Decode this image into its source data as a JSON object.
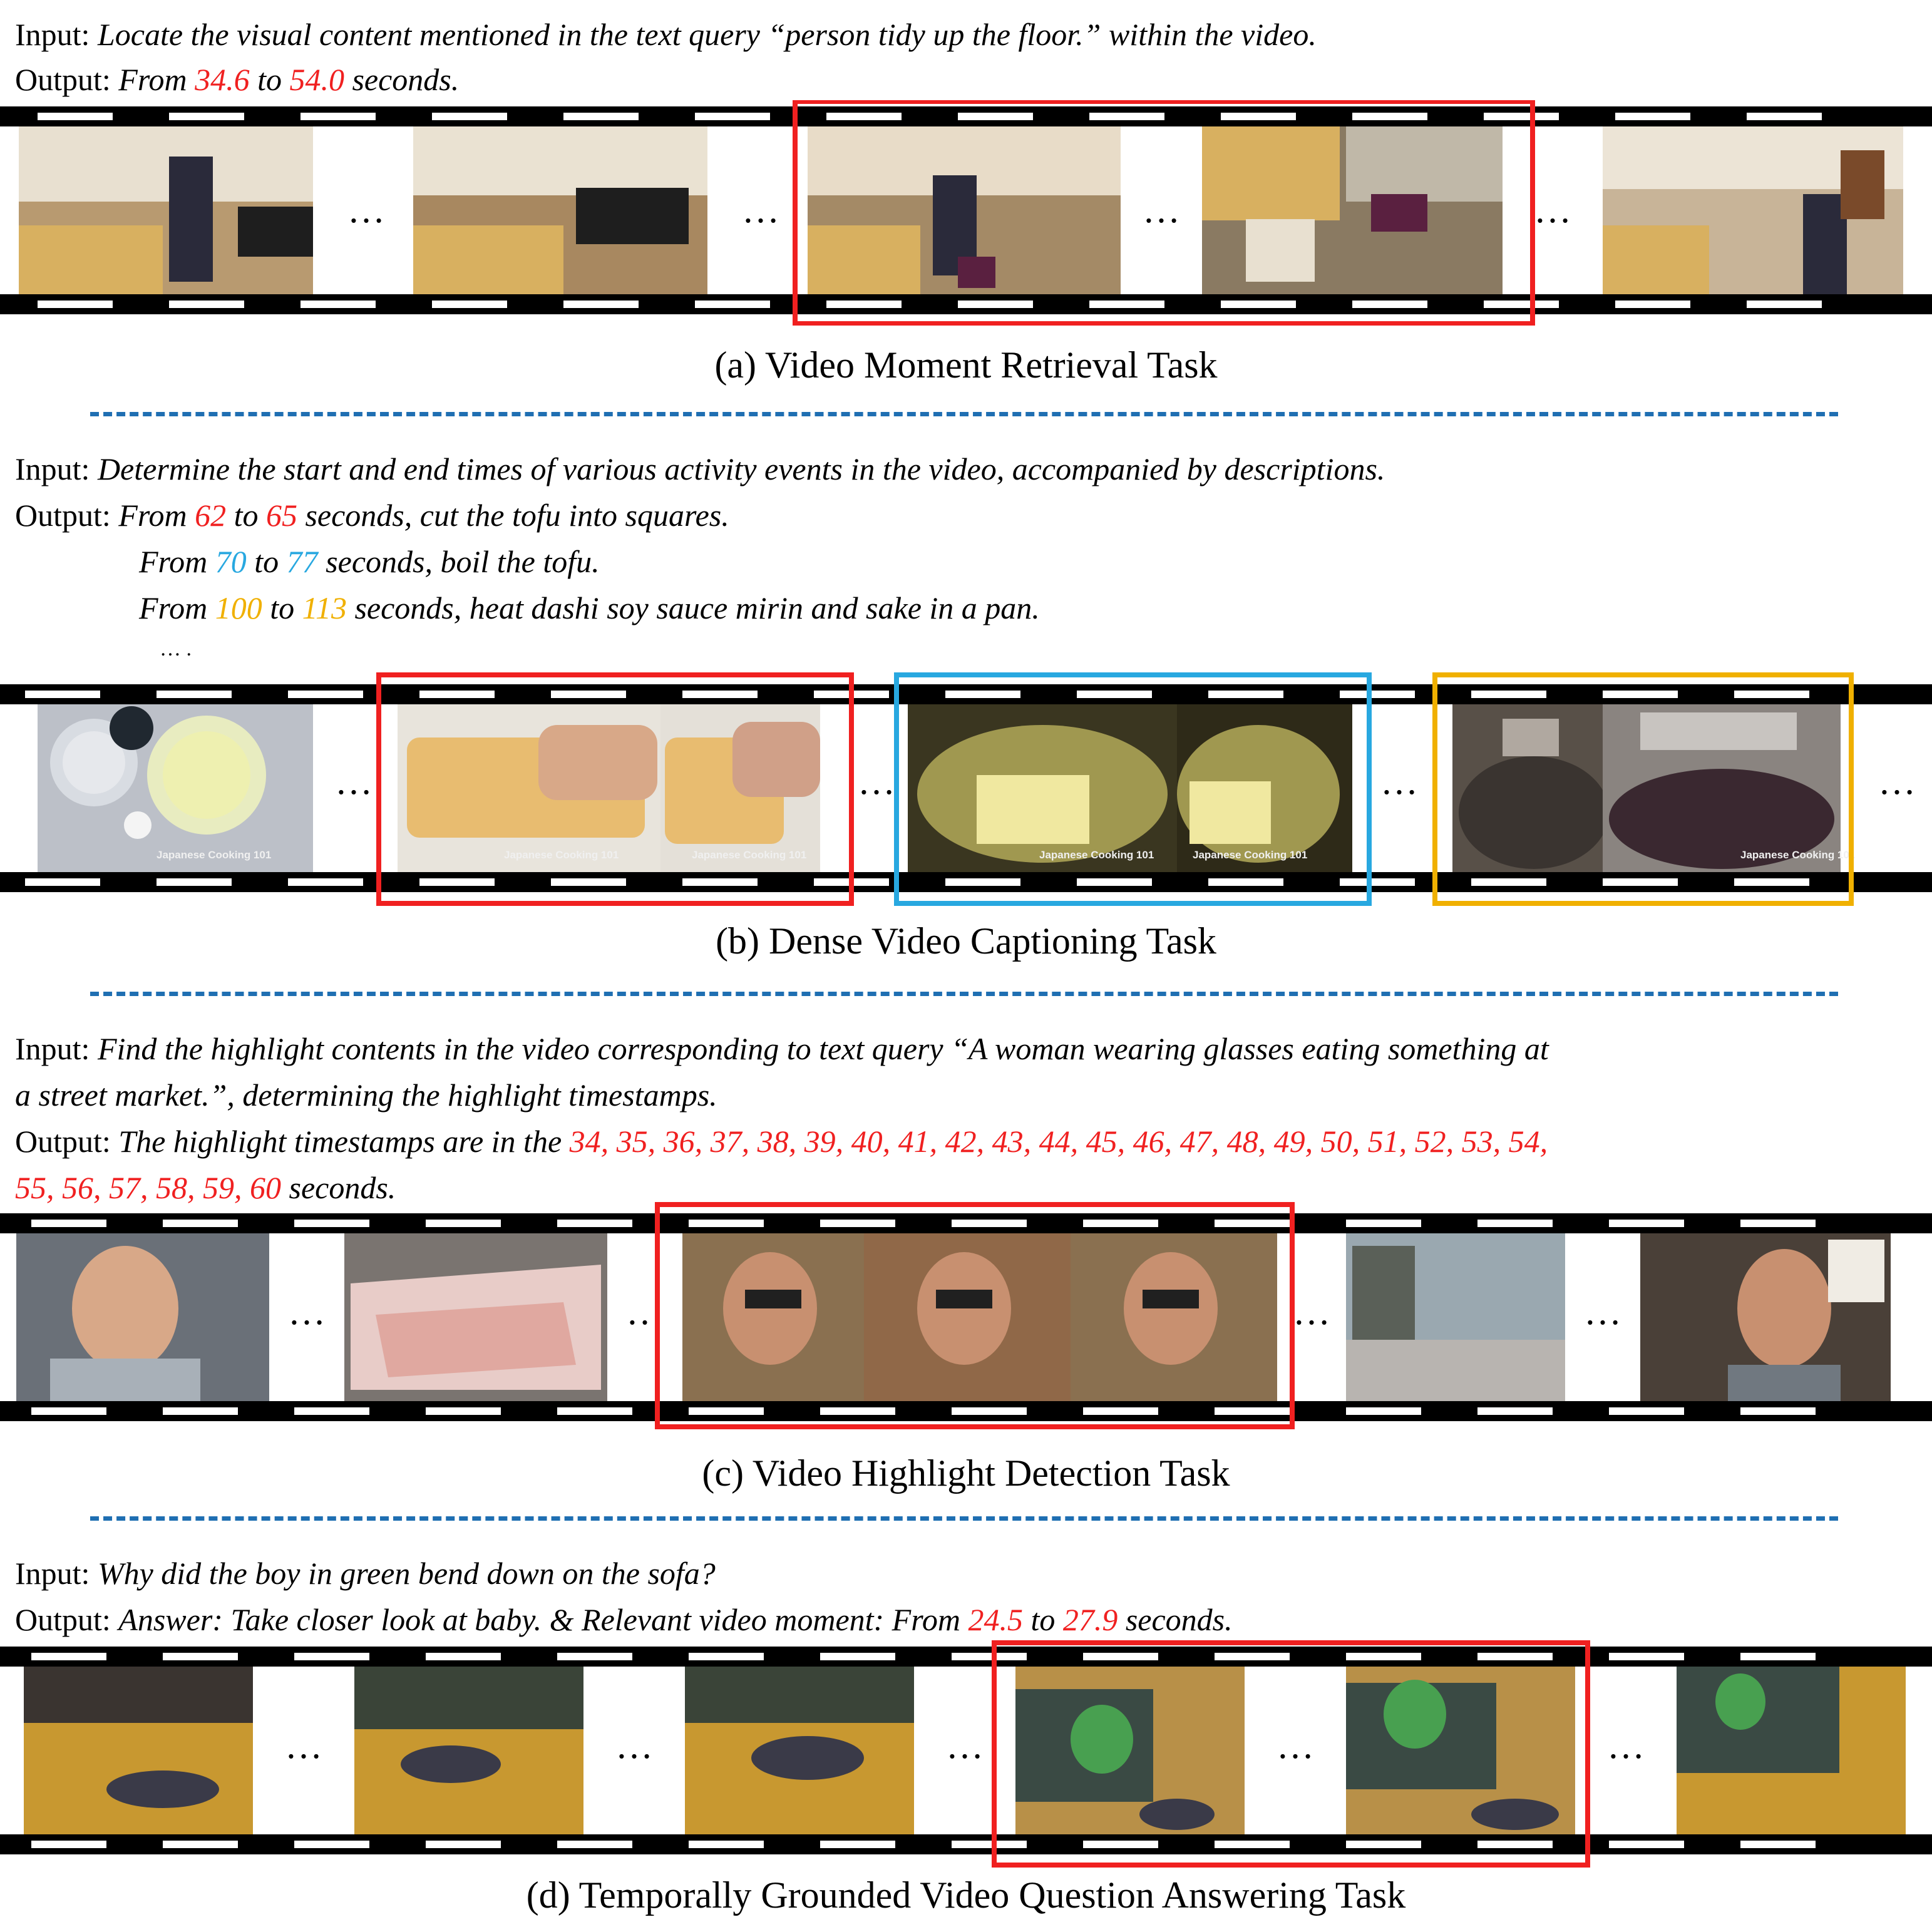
{
  "sections": [
    {
      "input_label": "Input:",
      "input_text": "Locate the visual content mentioned in the text query “person tidy up the floor.” within the video.",
      "output_label": "Output:",
      "output": {
        "a": "From ",
        "start": "34.6",
        "b": " to ",
        "end": "54.0",
        "c": " seconds."
      },
      "caption": "(a) Video Moment Retrieval Task"
    },
    {
      "input_label": "Input:",
      "input_text": "Determine the start and end times of various activity events in the video, accompanied by descriptions.",
      "output_label": "Output:",
      "events": [
        {
          "a": "From ",
          "start": "62",
          "b": " to ",
          "end": "65",
          "c": " seconds, cut the tofu into squares."
        },
        {
          "a": "From ",
          "start": "70",
          "b": " to ",
          "end": "77",
          "c": " seconds, boil the tofu."
        },
        {
          "a": "From ",
          "start": "100",
          "b": " to ",
          "end": "113",
          "c": " seconds, heat dashi soy sauce mirin and sake in a pan."
        }
      ],
      "more": "… .",
      "watermark": "Japanese Cooking 101",
      "caption": "(b) Dense Video Captioning Task"
    },
    {
      "input_label": "Input:",
      "input_line1": "Find the highlight contents in the video corresponding to text query “A woman wearing glasses eating something at",
      "input_line2": "a street market.”, determining the highlight timestamps.",
      "output_label": "Output:",
      "output_prefix": "The highlight timestamps are in the ",
      "timestamps_line1": "34, 35, 36, 37, 38, 39, 40, 41, 42, 43, 44, 45, 46, 47, 48, 49, 50, 51, 52, 53, 54,",
      "timestamps_line2": "55, 56, 57, 58, 59, 60",
      "output_suffix": " seconds.",
      "caption": "(c) Video Highlight Detection Task"
    },
    {
      "input_label": "Input:",
      "input_text": "Why did the boy in green bend down on the sofa?",
      "output_label": "Output:",
      "output": {
        "a": "Answer: Take closer look at baby. & Relevant video moment: From ",
        "start": "24.5",
        "b": " to ",
        "end": "27.9",
        "c": " seconds."
      },
      "caption": "(d) Temporally Grounded Video Question Answering Task"
    }
  ],
  "ellipsis": "…",
  "colors": {
    "red": "#f02020",
    "cyan": "#28a8e0",
    "gold": "#f0b000",
    "separator": "#1f6fb2",
    "film": "#000000"
  }
}
